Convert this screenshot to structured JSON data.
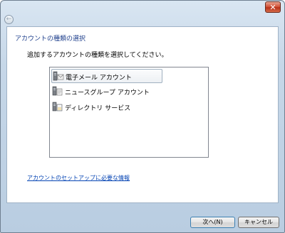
{
  "window": {
    "close_glyph": "✕",
    "back_glyph": "←"
  },
  "content": {
    "header": "アカウントの種類の選択",
    "prompt": "追加するアカウントの種類を選択してください。",
    "account_types": [
      {
        "label": "電子メール アカウント",
        "icon": "email-account-icon",
        "selected": true
      },
      {
        "label": "ニュースグループ アカウント",
        "icon": "newsgroup-account-icon",
        "selected": false
      },
      {
        "label": "ディレクトリ サービス",
        "icon": "directory-service-icon",
        "selected": false
      }
    ],
    "help_link": "アカウントのセットアップに必要な情報"
  },
  "footer": {
    "next_label": "次へ(N)",
    "cancel_label": "キャンセル"
  },
  "colors": {
    "header_text": "#1e3f8c",
    "link": "#0645b4",
    "frame": "#c6d7e8"
  }
}
